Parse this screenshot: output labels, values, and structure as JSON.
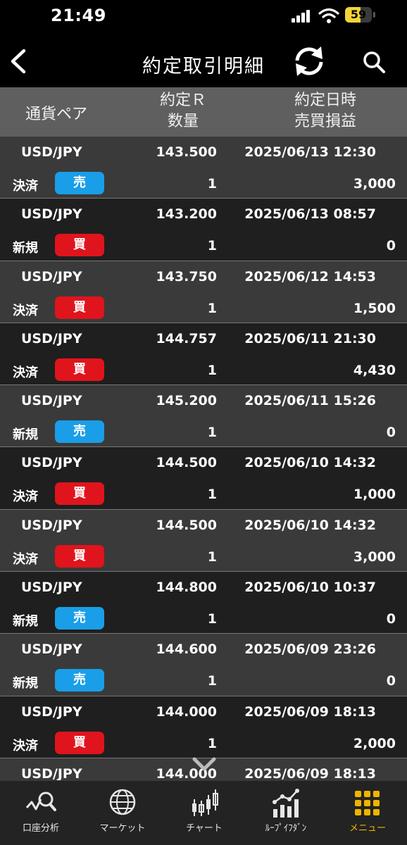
{
  "status_bar": {
    "time": "21:49",
    "battery": "59"
  },
  "nav": {
    "title": "約定取引明細",
    "back_icon": "back-chevron-icon",
    "refresh_icon": "refresh-icon",
    "search_icon": "search-icon"
  },
  "columns": {
    "pair": "通貨ペア",
    "rate": "約定Ｒ",
    "qty": "数量",
    "datetime": "約定日時",
    "pnl": "売買損益"
  },
  "trades": [
    {
      "pair": "USD/JPY",
      "rate": "143.500",
      "datetime": "2025/06/13 12:30",
      "kind": "決済",
      "side": "売",
      "side_type": "sell",
      "qty": "1",
      "pnl": "3,000"
    },
    {
      "pair": "USD/JPY",
      "rate": "143.200",
      "datetime": "2025/06/13 08:57",
      "kind": "新規",
      "side": "買",
      "side_type": "buy",
      "qty": "1",
      "pnl": "0"
    },
    {
      "pair": "USD/JPY",
      "rate": "143.750",
      "datetime": "2025/06/12 14:53",
      "kind": "決済",
      "side": "買",
      "side_type": "buy",
      "qty": "1",
      "pnl": "1,500"
    },
    {
      "pair": "USD/JPY",
      "rate": "144.757",
      "datetime": "2025/06/11 21:30",
      "kind": "決済",
      "side": "買",
      "side_type": "buy",
      "qty": "1",
      "pnl": "4,430"
    },
    {
      "pair": "USD/JPY",
      "rate": "145.200",
      "datetime": "2025/06/11 15:26",
      "kind": "新規",
      "side": "売",
      "side_type": "sell",
      "qty": "1",
      "pnl": "0"
    },
    {
      "pair": "USD/JPY",
      "rate": "144.500",
      "datetime": "2025/06/10 14:32",
      "kind": "決済",
      "side": "買",
      "side_type": "buy",
      "qty": "1",
      "pnl": "1,000"
    },
    {
      "pair": "USD/JPY",
      "rate": "144.500",
      "datetime": "2025/06/10 14:32",
      "kind": "決済",
      "side": "買",
      "side_type": "buy",
      "qty": "1",
      "pnl": "3,000"
    },
    {
      "pair": "USD/JPY",
      "rate": "144.800",
      "datetime": "2025/06/10 10:37",
      "kind": "新規",
      "side": "売",
      "side_type": "sell",
      "qty": "1",
      "pnl": "0"
    },
    {
      "pair": "USD/JPY",
      "rate": "144.600",
      "datetime": "2025/06/09 23:26",
      "kind": "新規",
      "side": "売",
      "side_type": "sell",
      "qty": "1",
      "pnl": "0"
    },
    {
      "pair": "USD/JPY",
      "rate": "144.000",
      "datetime": "2025/06/09 18:13",
      "kind": "決済",
      "side": "買",
      "side_type": "buy",
      "qty": "1",
      "pnl": "2,000"
    },
    {
      "pair": "USD/JPY",
      "rate": "144.000",
      "datetime": "2025/06/09 18:13",
      "kind": "",
      "side": "",
      "side_type": "",
      "qty": "",
      "pnl": ""
    }
  ],
  "tabs": [
    {
      "label": "口座分析",
      "icon": "account-analysis-icon",
      "active": false
    },
    {
      "label": "マーケット",
      "icon": "globe-icon",
      "active": false
    },
    {
      "label": "チャート",
      "icon": "candlestick-chart-icon",
      "active": false
    },
    {
      "label": "ﾙｰﾌﾟｲﾌﾀﾞﾝ",
      "icon": "bar-trend-icon",
      "active": false
    },
    {
      "label": "メニュー",
      "icon": "menu-grid-icon",
      "active": true
    }
  ],
  "colors": {
    "sell": "#1a9ee8",
    "buy": "#e0141c",
    "active_tab": "#f0b400",
    "header_bg": "#5f5f5f"
  }
}
